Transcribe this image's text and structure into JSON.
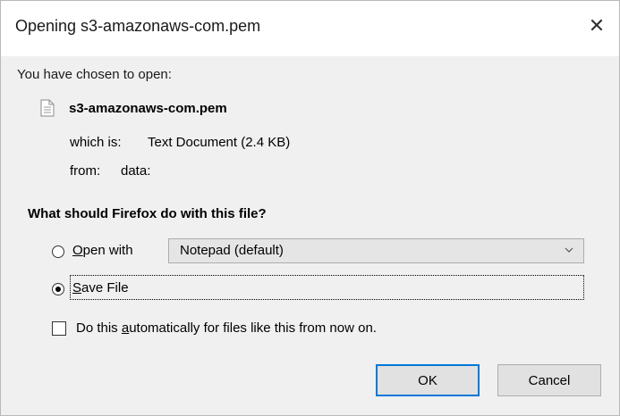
{
  "window": {
    "title": "Opening s3-amazonaws-com.pem",
    "close_glyph": "✕"
  },
  "dialog": {
    "chosen_text": "You have chosen to open:",
    "file_icon": "text-document-icon",
    "filename": "s3-amazonaws-com.pem",
    "which_label": "which is:",
    "which_value": "Text Document (2.4 KB)",
    "from_label": "from:",
    "from_value": "data:",
    "question": "What should Firefox do with this file?",
    "open_with": {
      "label_accesskey": "O",
      "label_rest": "pen with",
      "selected": false,
      "select_value": "Notepad (default)"
    },
    "save_file": {
      "label_accesskey": "S",
      "label_rest": "ave File",
      "selected": true
    },
    "auto": {
      "label_before": "Do this ",
      "label_accesskey": "a",
      "label_after": "utomatically for files like this from now on.",
      "checked": false
    },
    "buttons": {
      "ok": "OK",
      "cancel": "Cancel"
    }
  },
  "colors": {
    "accent": "#0078d7",
    "dialog_bg": "#f0f0f0",
    "button_bg": "#e1e1e1"
  }
}
